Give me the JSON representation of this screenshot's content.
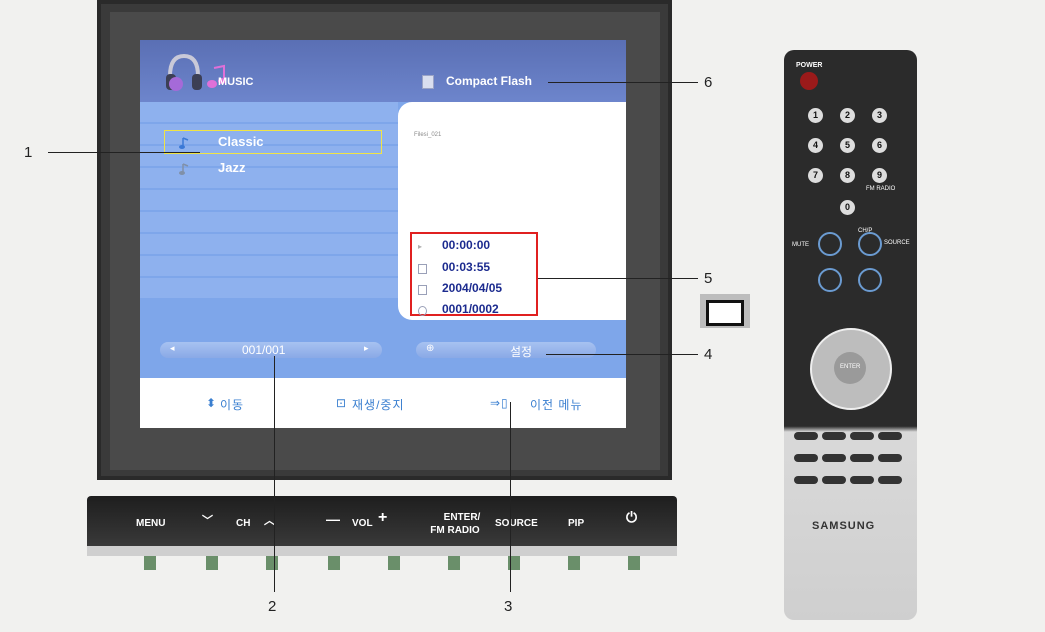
{
  "screen": {
    "header": {
      "title": "MUSIC",
      "source": "Compact Flash"
    },
    "playlist": [
      {
        "label": "Classic",
        "selected": true
      },
      {
        "label": "Jazz",
        "selected": false
      }
    ],
    "preview": {
      "filename": "Filesi_021"
    },
    "info": {
      "elapsed": "00:00:00",
      "duration": "00:03:55",
      "date": "2004/04/05",
      "index": "0001/0002"
    },
    "pagination": {
      "value": "001/001"
    },
    "settings": {
      "label": "설정"
    },
    "hints": {
      "move": "이동",
      "play_stop": "재생/중지",
      "previous_menu": "이전 메뉴"
    }
  },
  "control_panel": {
    "menu": "MENU",
    "ch": "CH",
    "vol": "VOL",
    "enter": "ENTER/",
    "fm_radio": "FM RADIO",
    "source": "SOURCE",
    "pip": "PIP"
  },
  "callouts": [
    "1",
    "2",
    "3",
    "4",
    "5",
    "6"
  ],
  "remote": {
    "brand": "SAMSUNG",
    "power": "POWER",
    "keys": [
      "1",
      "2",
      "3",
      "4",
      "5",
      "6",
      "7",
      "8",
      "9",
      "0"
    ],
    "fm_radio": "FM RADIO",
    "mute": "MUTE",
    "ch_p": "CH/P",
    "source": "SOURCE",
    "enter": "ENTER"
  },
  "colors": {
    "accent_blue": "#7ea6ea",
    "header_blue": "#5a6fb4",
    "highlight": "#f0e445",
    "callout_red": "#e02020",
    "info_text": "#1c2b8f"
  }
}
